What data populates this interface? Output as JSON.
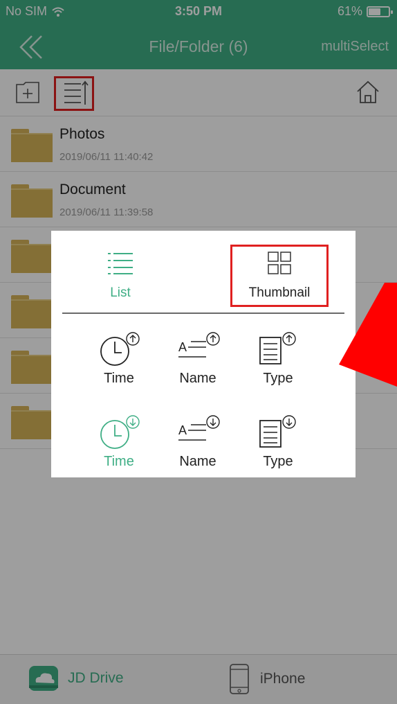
{
  "status_bar": {
    "carrier": "No SIM",
    "time": "3:50 PM",
    "battery": "61%",
    "battery_level": 0.61
  },
  "nav": {
    "title": "File/Folder (6)",
    "multi_select": "multiSelect"
  },
  "files": [
    {
      "name": "Photos",
      "date": "2019/06/11 11:40:42"
    },
    {
      "name": "Document",
      "date": "2019/06/11 11:39:58"
    },
    {
      "name": "",
      "date": ""
    },
    {
      "name": "",
      "date": ""
    },
    {
      "name": "",
      "date": ""
    },
    {
      "name": "",
      "date": ""
    }
  ],
  "popup": {
    "view_list_label": "List",
    "view_thumbnail_label": "Thumbnail",
    "sort_asc": [
      {
        "label": "Time",
        "icon": "clock-up-icon"
      },
      {
        "label": "Name",
        "icon": "name-up-icon"
      },
      {
        "label": "Type",
        "icon": "type-up-icon"
      }
    ],
    "sort_desc": [
      {
        "label": "Time",
        "icon": "clock-down-icon"
      },
      {
        "label": "Name",
        "icon": "name-down-icon"
      },
      {
        "label": "Type",
        "icon": "type-down-icon"
      }
    ]
  },
  "tabbar": {
    "jd_label": "JD Drive",
    "iphone_label": "iPhone"
  },
  "colors": {
    "accent": "#3fae85",
    "highlight": "#e02020",
    "folder": "#d6b357"
  }
}
